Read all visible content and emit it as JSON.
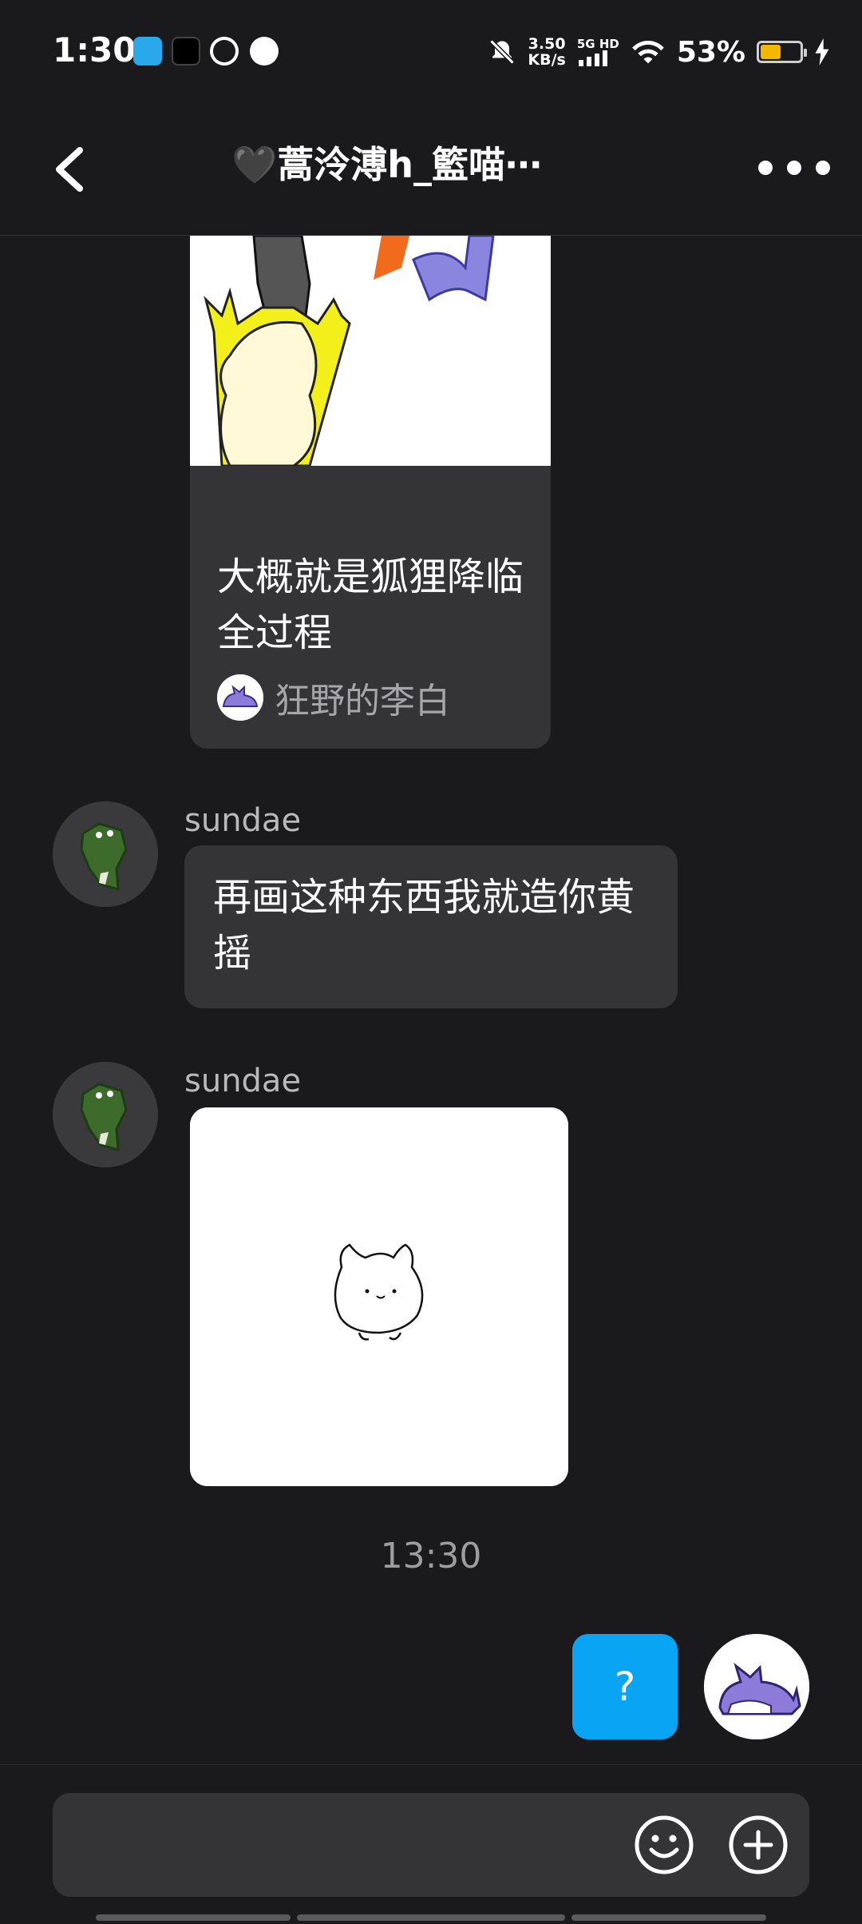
{
  "status_bar": {
    "time": "1:30",
    "net_speed_value": "3.50",
    "net_speed_unit": "KB/s",
    "network_label": "5G HD",
    "battery_percent": "53%",
    "battery_level": 0.53,
    "icons": [
      "telegram-icon",
      "tiktok-icon",
      "app-icon",
      "chat-icon",
      "mute-icon",
      "signal-icon",
      "wifi-icon",
      "battery-icon",
      "charging-icon"
    ]
  },
  "header": {
    "title": "🖤蒿泠溥h_籃喵⋯",
    "back_icon": "chevron-left-icon",
    "more_icon": "more-horizontal-icon"
  },
  "messages": {
    "shared_card": {
      "title": "大概就是狐狸降临全过程",
      "source_name": "狂野的李白"
    },
    "msg1": {
      "sender": "sundae",
      "text": "再画这种东西我就造你黄摇"
    },
    "msg2": {
      "sender": "sundae"
    },
    "timestamp": "13:30",
    "my_msg": {
      "text": "?"
    }
  },
  "input": {
    "placeholder": "",
    "emoji_icon": "emoji-icon",
    "add_icon": "plus-circle-icon"
  },
  "colors": {
    "background": "#1a191b",
    "bubble": "#343336",
    "accent_blue": "#0aa4f5",
    "muted_text": "#9d9ca1"
  }
}
